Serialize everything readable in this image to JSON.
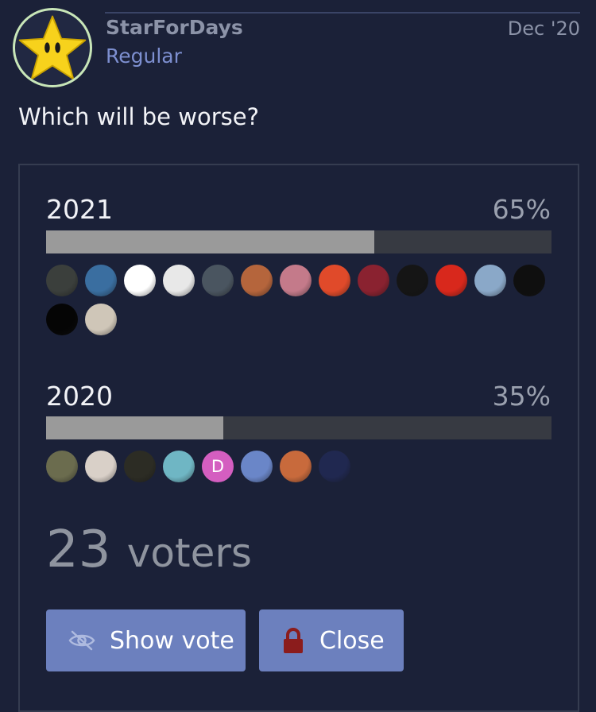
{
  "post": {
    "username": "StarForDays",
    "user_title": "Regular",
    "date": "Dec '20",
    "question": "Which will be worse?",
    "avatar_icon": "star-icon"
  },
  "poll": {
    "options": [
      {
        "label": "2021",
        "percent_label": "65%",
        "percent": 65,
        "voters": [
          "#3b3f3c",
          "#3a6ea0",
          "#ffffff",
          "#e8e8e8",
          "#4a5560",
          "#b5653c",
          "#c47a8a",
          "#e04a2a",
          "#8a2230",
          "#151515",
          "#d8281c",
          "#8aa8c8",
          "#0f0f0f",
          "#050505",
          "#cfc6b8"
        ]
      },
      {
        "label": "2020",
        "percent_label": "35%",
        "percent": 35,
        "voters": [
          "#6b6c4e",
          "#d9d0c8",
          "#2c2c24",
          "#6fb6c4",
          "D",
          "#6a86c8",
          "#c86a3c",
          "#202850"
        ]
      }
    ],
    "voters_number": "23",
    "voters_word": "voters",
    "buttons": {
      "show_vote": "Show vote",
      "close": "Close"
    },
    "colors": {
      "bar_fill": "#9a9a9a",
      "bar_track": "#373a42",
      "button": "#6c80be",
      "lock": "#8b1c1c",
      "letter_avatar": "#d45ec0"
    }
  }
}
